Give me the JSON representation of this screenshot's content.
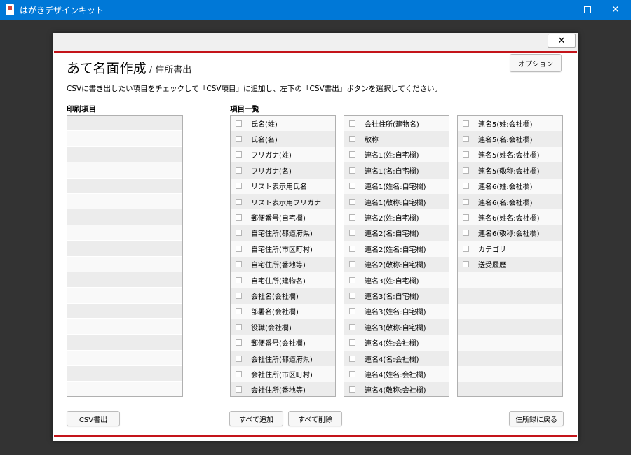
{
  "window": {
    "title": "はがきデザインキット",
    "minimize": "—",
    "maximize": "□",
    "close": "✕"
  },
  "dialog": {
    "close": "✕",
    "heading": "あて名面作成",
    "subheading": " / 住所書出",
    "option_button": "オプション",
    "instructions": "CSVに書き出したい項目をチェックして「CSV項目」に追加し、左下の「CSV書出」ボタンを選択してください。",
    "print_items_label": "印刷項目",
    "item_list_label": "項目一覧",
    "columns": [
      [
        "氏名(姓)",
        "氏名(名)",
        "フリガナ(姓)",
        "フリガナ(名)",
        "リスト表示用氏名",
        "リスト表示用フリガナ",
        "郵便番号(自宅欄)",
        "自宅住所(都道府県)",
        "自宅住所(市区町村)",
        "自宅住所(番地等)",
        "自宅住所(建物名)",
        "会社名(会社欄)",
        "部署名(会社欄)",
        "役職(会社欄)",
        "郵便番号(会社欄)",
        "会社住所(都道府県)",
        "会社住所(市区町村)",
        "会社住所(番地等)"
      ],
      [
        "会社住所(建物名)",
        "敬称",
        "連名1(姓:自宅欄)",
        "連名1(名:自宅欄)",
        "連名1(姓名:自宅欄)",
        "連名1(敬称:自宅欄)",
        "連名2(姓:自宅欄)",
        "連名2(名:自宅欄)",
        "連名2(姓名:自宅欄)",
        "連名2(敬称:自宅欄)",
        "連名3(姓:自宅欄)",
        "連名3(名:自宅欄)",
        "連名3(姓名:自宅欄)",
        "連名3(敬称:自宅欄)",
        "連名4(姓:会社欄)",
        "連名4(名:会社欄)",
        "連名4(姓名:会社欄)",
        "連名4(敬称:会社欄)"
      ],
      [
        "連名5(姓:会社欄)",
        "連名5(名:会社欄)",
        "連名5(姓名:会社欄)",
        "連名5(敬称:会社欄)",
        "連名6(姓:会社欄)",
        "連名6(名:会社欄)",
        "連名6(姓名:会社欄)",
        "連名6(敬称:会社欄)",
        "カテゴリ",
        "送受履歴"
      ]
    ],
    "buttons": {
      "csv_export": "CSV書出",
      "add_all": "すべて追加",
      "remove_all": "すべて削除",
      "back_to_address_book": "住所録に戻る"
    }
  }
}
